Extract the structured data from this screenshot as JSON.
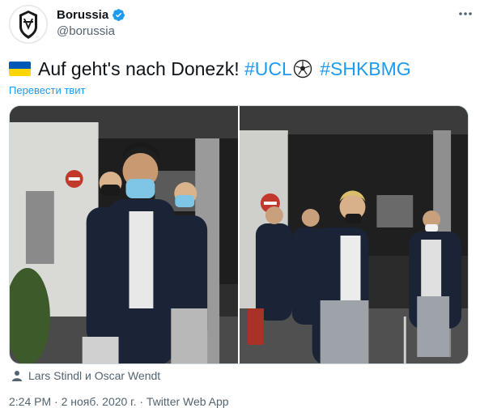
{
  "account": {
    "display_name": "Borussia",
    "handle": "@borussia",
    "verified": true,
    "avatar_icon": "borussia-crest-icon"
  },
  "tweet": {
    "flag_icon": "ukraine-flag-icon",
    "text_main": "Auf geht's nach Donezk!",
    "hashtag_ucl": "#UCL",
    "ball_icon": "soccer-ball-icon",
    "hashtag_match": "#SHKBMG",
    "translate_label": "Перевести твит"
  },
  "media": {
    "tagged_icon": "person-icon",
    "tagged_people": "Lars Stindl и Oscar Wendt"
  },
  "meta": {
    "timestamp_line": "2:24 PM · 2 нояб. 2020 г. · Twitter Web App"
  },
  "colors": {
    "accent": "#1d9bf0",
    "secondary_text": "#536471",
    "flag_blue": "#0057b7",
    "flag_yellow": "#ffd700"
  }
}
